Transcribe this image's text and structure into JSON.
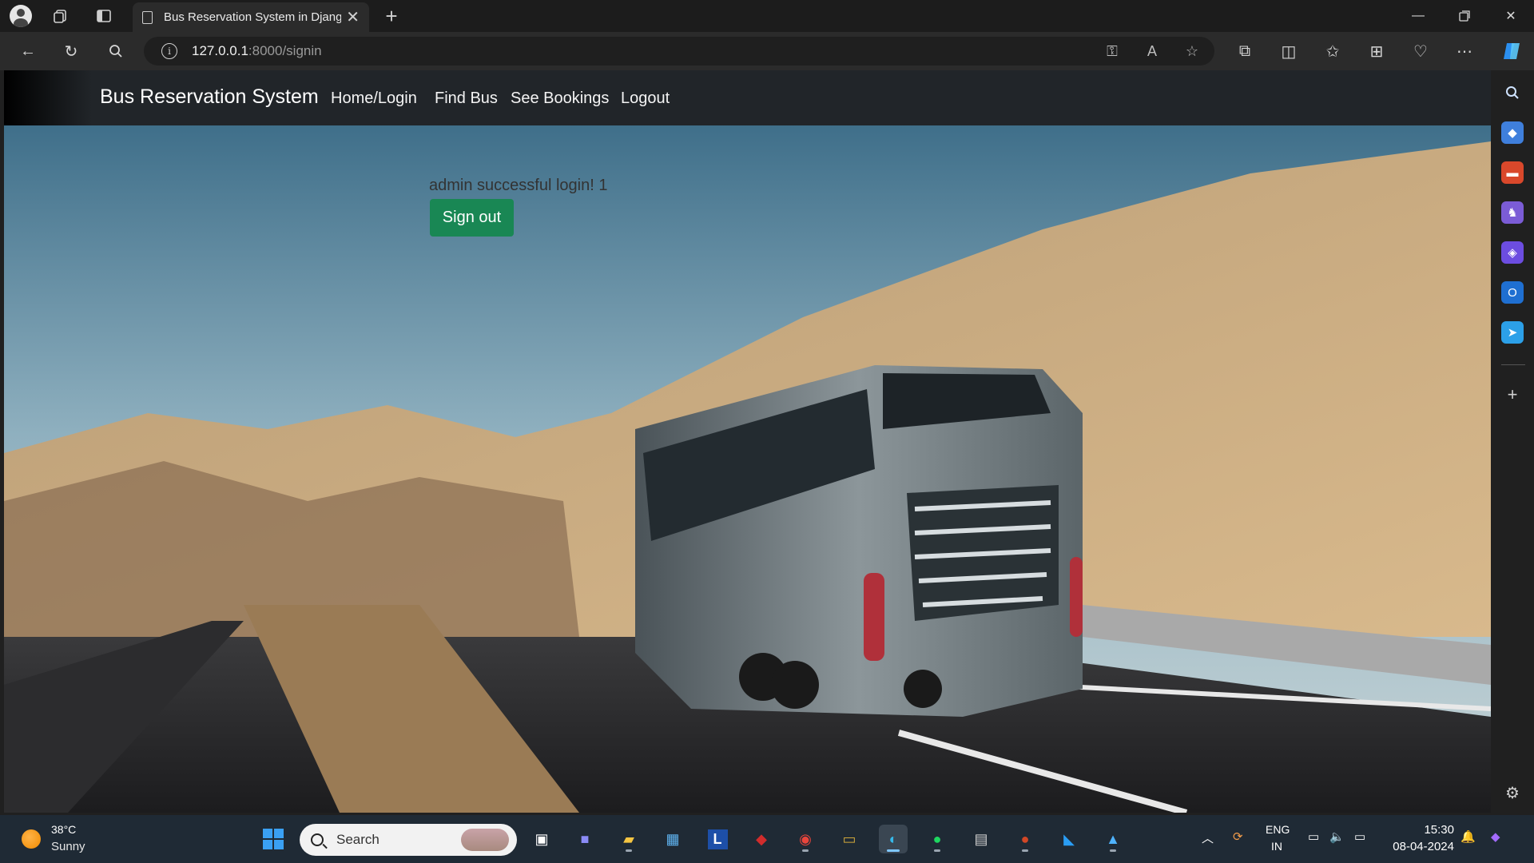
{
  "browser": {
    "tab_title": "Bus Reservation System in Djang",
    "url_host": "127.0.0.1",
    "url_path": ":8000/signin",
    "toolbar_icons": [
      "profile-icon",
      "workspaces-icon",
      "tab-actions-icon",
      "back-icon",
      "refresh-icon",
      "search-icon",
      "info-icon",
      "password-key-icon",
      "read-aloud-icon",
      "favorite-star-icon",
      "extensions-icon",
      "split-screen-icon",
      "favorites-icon",
      "collections-icon",
      "browser-essentials-icon",
      "more-icon",
      "copilot-icon"
    ]
  },
  "sidebar": {
    "icons": [
      "search-icon",
      "shopping-tag-icon",
      "tools-icon",
      "games-icon",
      "copilot-icon",
      "outlook-icon",
      "send-icon",
      "add-icon",
      "settings-icon"
    ]
  },
  "site": {
    "brand": "Bus Reservation System",
    "nav": [
      "Home/Login",
      "Find Bus",
      "See Bookings",
      "Logout"
    ],
    "message": "admin successful login! 1",
    "signout_label": "Sign out"
  },
  "taskbar": {
    "weather_temp": "38°C",
    "weather_cond": "Sunny",
    "search_label": "Search",
    "lang_1": "ENG",
    "lang_2": "IN",
    "time": "15:30",
    "date": "08-04-2024",
    "colors": {
      "start": "#3aa0f3",
      "accent": "#198754"
    }
  }
}
